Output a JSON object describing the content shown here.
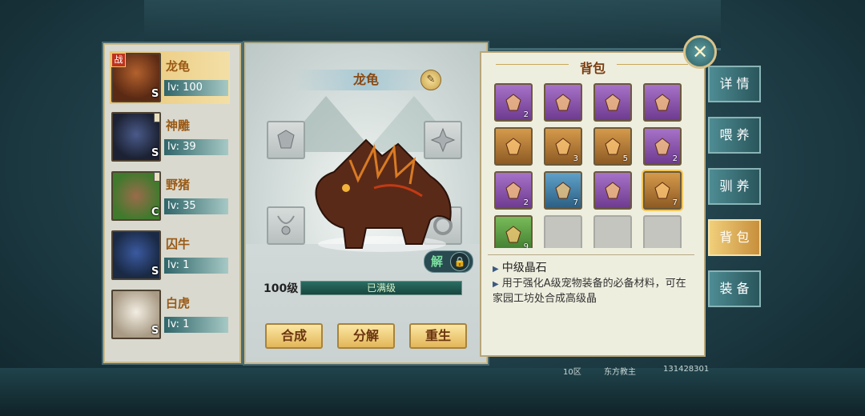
{
  "pets": [
    {
      "name": "龙龟",
      "level": "lv: 100",
      "grade": "S",
      "battle_tag": "战",
      "selected": true
    },
    {
      "name": "神雕",
      "level": "lv: 39",
      "grade": "S",
      "selected": false
    },
    {
      "name": "野猪",
      "level": "lv: 35",
      "grade": "C",
      "selected": false
    },
    {
      "name": "囚牛",
      "level": "lv: 1",
      "grade": "S",
      "selected": false
    },
    {
      "name": "白虎",
      "level": "lv: 1",
      "grade": "S",
      "selected": false
    }
  ],
  "detail": {
    "pet_name": "龙龟",
    "edit_icon": "edit-icon",
    "unlock_label": "解",
    "level_label": "100级",
    "exp_label": "已满级",
    "exp_fraction": 1.0,
    "buttons": {
      "combine": "合成",
      "decompose": "分解",
      "rebirth": "重生"
    }
  },
  "bag": {
    "title": "背包",
    "items": [
      {
        "color": "purple",
        "count": "2"
      },
      {
        "color": "purple",
        "count": ""
      },
      {
        "color": "purple",
        "count": ""
      },
      {
        "color": "purple",
        "count": ""
      },
      {
        "color": "orange",
        "count": ""
      },
      {
        "color": "orange",
        "count": "3"
      },
      {
        "color": "orange",
        "count": "5"
      },
      {
        "color": "purple",
        "count": "2"
      },
      {
        "color": "purple",
        "count": "2"
      },
      {
        "color": "blue",
        "count": "7"
      },
      {
        "color": "purple",
        "count": ""
      },
      {
        "color": "orange",
        "count": "7",
        "selected": true
      },
      {
        "color": "green",
        "count": "9"
      },
      {
        "color": "empty",
        "count": ""
      },
      {
        "color": "empty",
        "count": ""
      },
      {
        "color": "empty",
        "count": ""
      }
    ],
    "selected_item": {
      "name": "中级晶石",
      "description": "用于强化A级宠物装备的必备材料，可在家园工坊处合成高级晶"
    }
  },
  "tabs": [
    {
      "label": "详 情",
      "active": false
    },
    {
      "label": "喂 养",
      "active": false
    },
    {
      "label": "驯 养",
      "active": false
    },
    {
      "label": "背 包",
      "active": true
    },
    {
      "label": "装 备",
      "active": false
    }
  ],
  "footer": {
    "server": "10区",
    "player": "东方教主",
    "id": "131428301"
  },
  "colors": {
    "accent_gold": "#e3b65a",
    "panel_teal": "#4e8c93",
    "text_brown": "#8a4a15"
  }
}
